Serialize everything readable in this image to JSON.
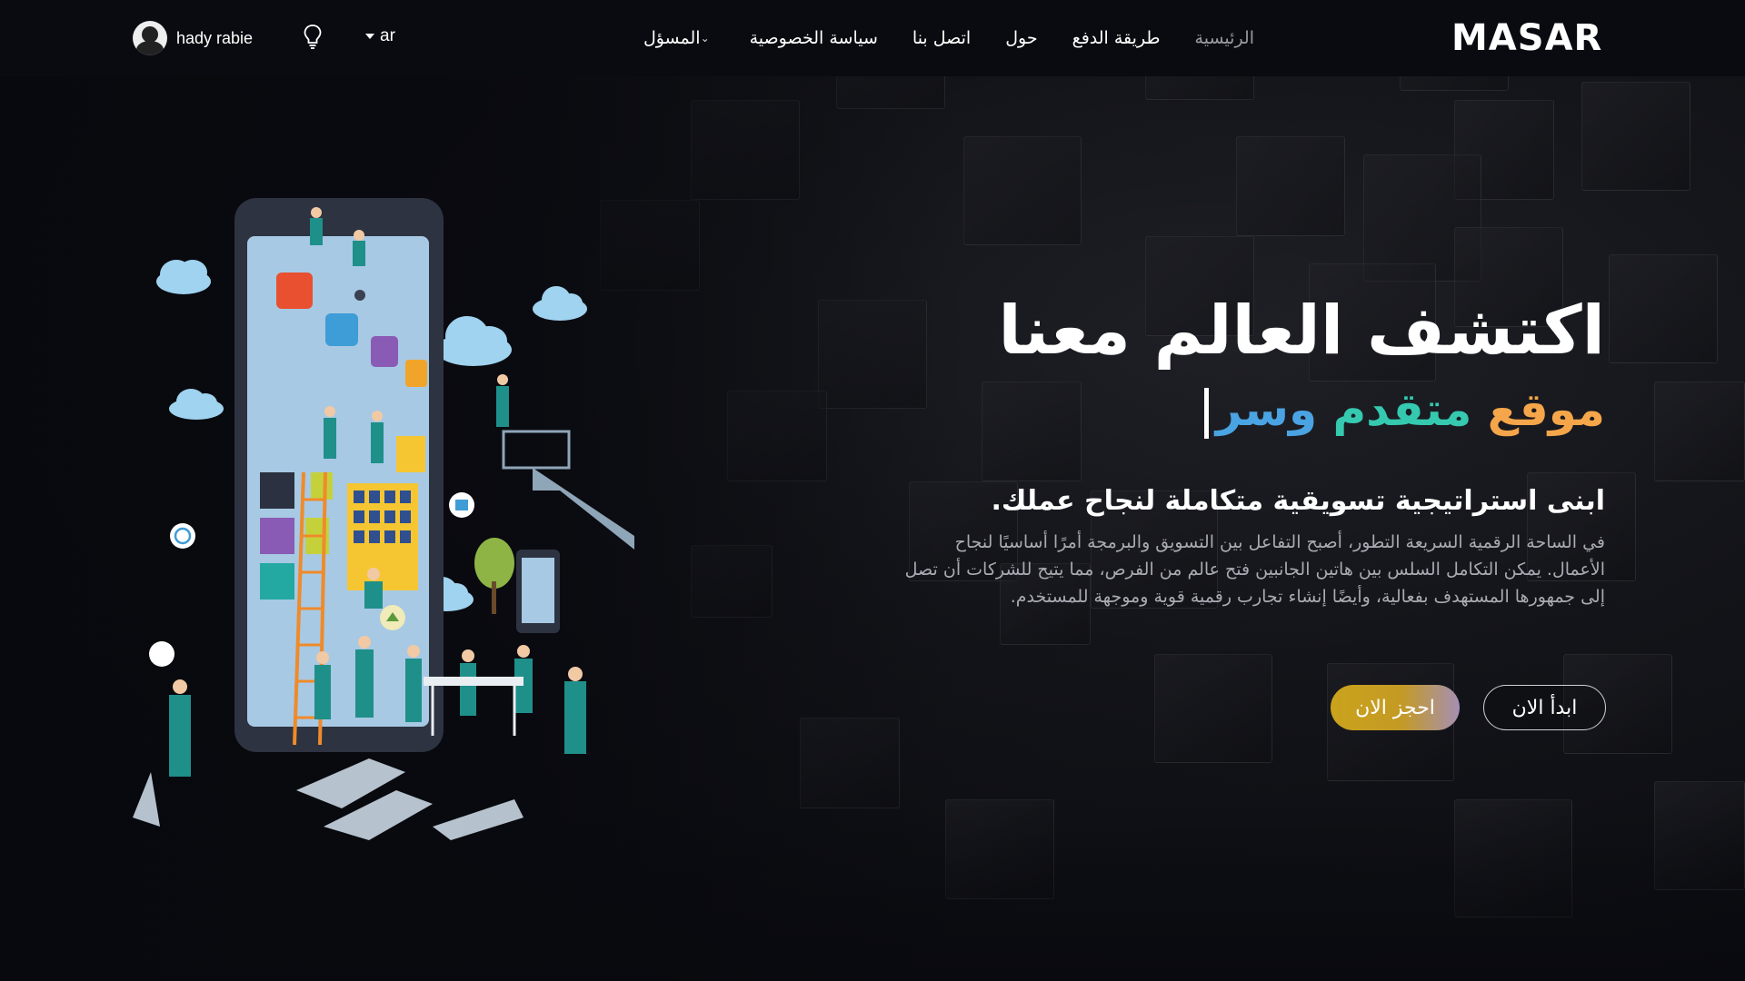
{
  "header": {
    "logo_text": "MASAR",
    "nav": [
      {
        "label": "الرئيسية",
        "active": true
      },
      {
        "label": "طريقة الدفع",
        "active": false
      },
      {
        "label": "حول",
        "active": false
      },
      {
        "label": "اتصل بنا",
        "active": false
      },
      {
        "label": "سياسة الخصوصية",
        "active": false
      },
      {
        "label": "المسؤل",
        "active": false,
        "dropdown": true
      }
    ],
    "user_name": "hady rabie",
    "language": "ar",
    "icons": {
      "theme": "lightbulb-icon",
      "user": "avatar",
      "dropdown": "chevron-down-icon",
      "lang": "caret-down-icon"
    }
  },
  "hero": {
    "title": "اكتشف العالم معنا",
    "subtitle_words": [
      "موقع",
      "متقدم",
      "وسر"
    ],
    "heading": "ابنى استراتيجية تسويقية متكاملة لنجاح عملك.",
    "paragraph": "في الساحة الرقمية السريعة التطور، أصبح التفاعل بين التسويق والبرمجة أمرًا أساسيًا لنجاح الأعمال. يمكن التكامل السلس بين هاتين الجانبين فتح عالم من الفرص، مما يتيح للشركات أن تصل إلى جمهورها المستهدف بفعالية، وأيضًا إنشاء تجارب رقمية قوية وموجهة للمستخدم.",
    "buttons": {
      "start": "ابدأ الان",
      "book": "احجز الان"
    }
  },
  "colors": {
    "background": "#0b0c12",
    "accent_gold": "#caa31c",
    "accent_orange": "#f5a54a",
    "accent_teal": "#35c9b0",
    "accent_blue": "#4aa3e2",
    "nav_active": "#9a9ba3"
  }
}
